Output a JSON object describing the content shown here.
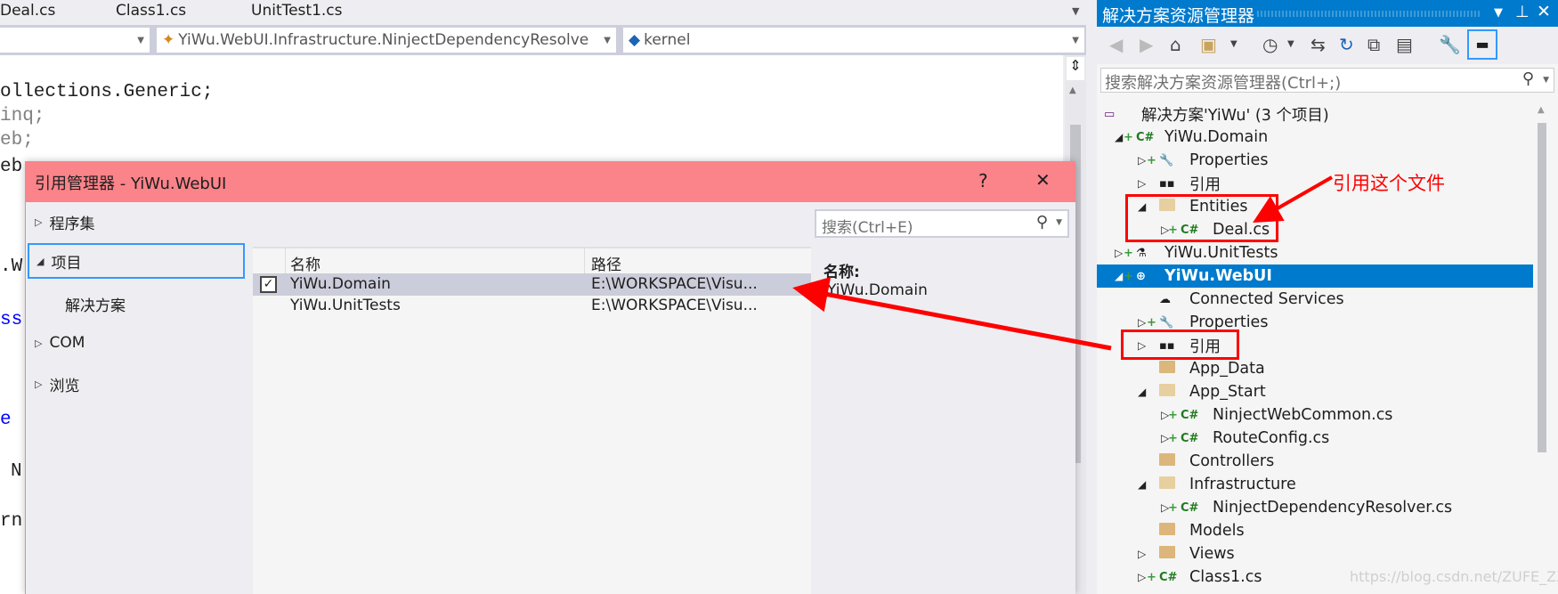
{
  "editor": {
    "tabs": [
      "Deal.cs",
      "Class1.cs",
      "UnitTest1.cs"
    ],
    "nav_type": "YiWu.WebUI.Infrastructure.NinjectDependencyResolve",
    "nav_member": "kernel",
    "code_lines": [
      {
        "text": "ollections.Generic;",
        "color": "#000000"
      },
      {
        "text": "inq;",
        "color": "#808080"
      },
      {
        "text": "eb;",
        "color": "#808080"
      },
      {
        "text": "eb",
        "color": "#000000"
      },
      {
        "text": ".W",
        "color": "#000000"
      },
      {
        "text": "ss",
        "color": "#0000ff"
      },
      {
        "text": "e",
        "color": "#0000ff"
      },
      {
        "text": "N",
        "color": "#000000"
      },
      {
        "text": "rn",
        "color": "#000000"
      }
    ]
  },
  "dialog": {
    "title": "引用管理器 - YiWu.WebUI",
    "help": "?",
    "close": "✕",
    "nav": [
      {
        "label": "程序集",
        "expanded": false
      },
      {
        "label": "项目",
        "expanded": true,
        "selected": true
      },
      {
        "label": "解决方案",
        "child": true
      },
      {
        "label": "COM",
        "expanded": false
      },
      {
        "label": "浏览",
        "expanded": false
      }
    ],
    "search_placeholder": "搜索(Ctrl+E)",
    "columns": [
      "名称",
      "路径"
    ],
    "rows": [
      {
        "checked": true,
        "name": "YiWu.Domain",
        "path": "E:\\WORKSPACE\\Visu...",
        "selected": true
      },
      {
        "checked": false,
        "name": "YiWu.UnitTests",
        "path": "E:\\WORKSPACE\\Visu..."
      }
    ],
    "detail_label": "名称:",
    "detail_value": "YiWu.Domain"
  },
  "solution_explorer": {
    "title": "解决方案资源管理器",
    "search_placeholder": "搜索解决方案资源管理器(Ctrl+;)",
    "accent": "#007acc",
    "tree": [
      {
        "label": "解决方案'YiWu' (3 个项目)",
        "level": 0,
        "icon": "solution-icon"
      },
      {
        "label": "YiWu.Domain",
        "level": 1,
        "exp": "open",
        "icon": "csharp-project-icon"
      },
      {
        "label": "Properties",
        "level": 2,
        "exp": "closed",
        "icon": "wrench-icon"
      },
      {
        "label": "引用",
        "level": 2,
        "exp": "closed",
        "icon": "references-icon"
      },
      {
        "label": "Entities",
        "level": 2,
        "exp": "open",
        "icon": "folder-open-icon"
      },
      {
        "label": "Deal.cs",
        "level": 3,
        "exp": "closed",
        "icon": "csharp-file-icon"
      },
      {
        "label": "YiWu.UnitTests",
        "level": 1,
        "exp": "closed",
        "icon": "test-project-icon"
      },
      {
        "label": "YiWu.WebUI",
        "level": 1,
        "exp": "open",
        "icon": "web-project-icon",
        "selected": true
      },
      {
        "label": "Connected Services",
        "level": 2,
        "icon": "cloud-icon"
      },
      {
        "label": "Properties",
        "level": 2,
        "exp": "closed",
        "icon": "wrench-icon"
      },
      {
        "label": "引用",
        "level": 2,
        "exp": "closed",
        "icon": "references-icon"
      },
      {
        "label": "App_Data",
        "level": 2,
        "icon": "folder-icon"
      },
      {
        "label": "App_Start",
        "level": 2,
        "exp": "open",
        "icon": "folder-open-icon"
      },
      {
        "label": "NinjectWebCommon.cs",
        "level": 3,
        "exp": "closed",
        "icon": "csharp-file-icon"
      },
      {
        "label": "RouteConfig.cs",
        "level": 3,
        "exp": "closed",
        "icon": "csharp-file-icon"
      },
      {
        "label": "Controllers",
        "level": 2,
        "icon": "folder-icon"
      },
      {
        "label": "Infrastructure",
        "level": 2,
        "exp": "open",
        "icon": "folder-open-icon"
      },
      {
        "label": "NinjectDependencyResolver.cs",
        "level": 3,
        "exp": "closed",
        "icon": "csharp-file-icon"
      },
      {
        "label": "Models",
        "level": 2,
        "icon": "folder-icon"
      },
      {
        "label": "Views",
        "level": 2,
        "exp": "closed",
        "icon": "folder-icon"
      },
      {
        "label": "Class1.cs",
        "level": 2,
        "exp": "closed",
        "icon": "csharp-file-icon"
      }
    ]
  },
  "annotation": {
    "label": "引用这个文件",
    "color": "#ff0000"
  },
  "watermark": "https://blog.csdn.net/ZUFE_ZXh"
}
